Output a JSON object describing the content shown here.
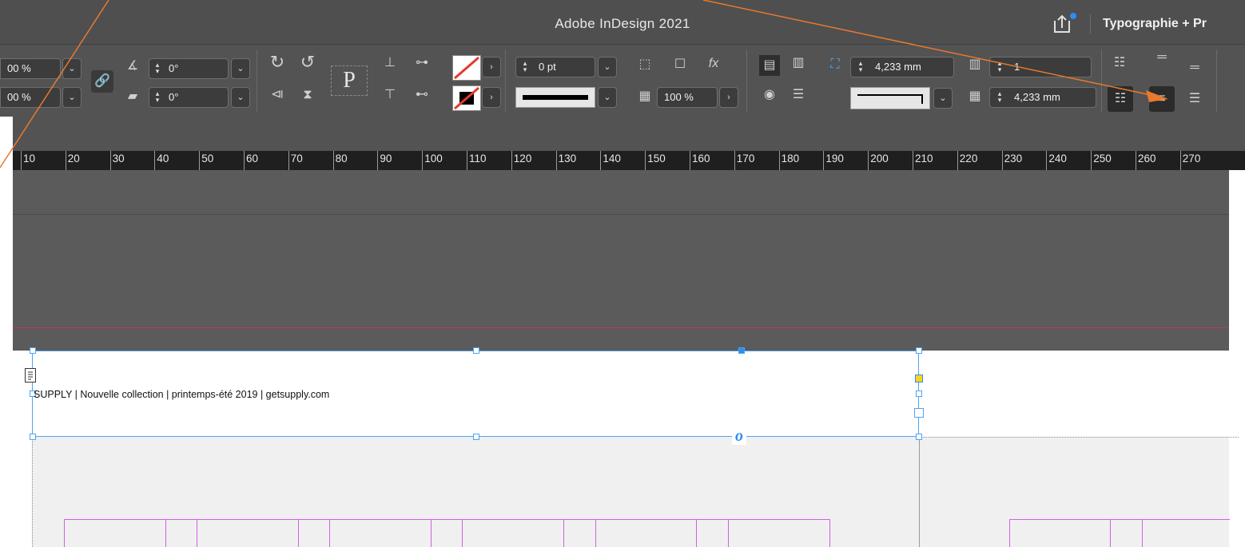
{
  "window": {
    "title": "Adobe InDesign 2021",
    "workspace": "Typographie + Pr"
  },
  "control": {
    "scale_x": "00 %",
    "scale_y": "00 %",
    "rotation": "0°",
    "shear": "0°",
    "proxy_letter": "P",
    "stroke_weight": "0 pt",
    "opacity": "100 %",
    "gap": "4,233 mm",
    "columns": "1",
    "gutter": "4,233 mm",
    "fx_label": "fx"
  },
  "ruler": {
    "labels": [
      "10",
      "20",
      "30",
      "40",
      "50",
      "60",
      "70",
      "80",
      "90",
      "100",
      "110",
      "120",
      "130",
      "140",
      "150",
      "160",
      "170",
      "180",
      "190",
      "200",
      "210",
      "220",
      "230",
      "240",
      "250",
      "260",
      "270"
    ]
  },
  "document": {
    "footer_text": "SUPPLY | Nouvelle collection | printemps-été 2019 | getsupply.com",
    "overset_glyph": "o"
  },
  "colors": {
    "accent": "#4fa3f7",
    "annotation_arrow": "#e8792f",
    "bleed_guide": "#c2365f",
    "margin_guide": "#d25fe4"
  },
  "icons": [
    "share-icon",
    "lock-proportions-icon",
    "rotate-icon",
    "shear-icon",
    "rotate-cw-icon",
    "rotate-ccw-icon",
    "flip-horizontal-icon",
    "flip-vertical-icon",
    "align-icon",
    "distribute-icon",
    "fill-swatch-icon",
    "stroke-swatch-icon",
    "text-wrap-icon",
    "frame-icon",
    "fx-icon",
    "align-left-icon",
    "align-center-icon",
    "auto-size-icon",
    "columns-icon",
    "gutter-icon",
    "justify-icon",
    "align-top-icon",
    "align-bottom-icon"
  ]
}
